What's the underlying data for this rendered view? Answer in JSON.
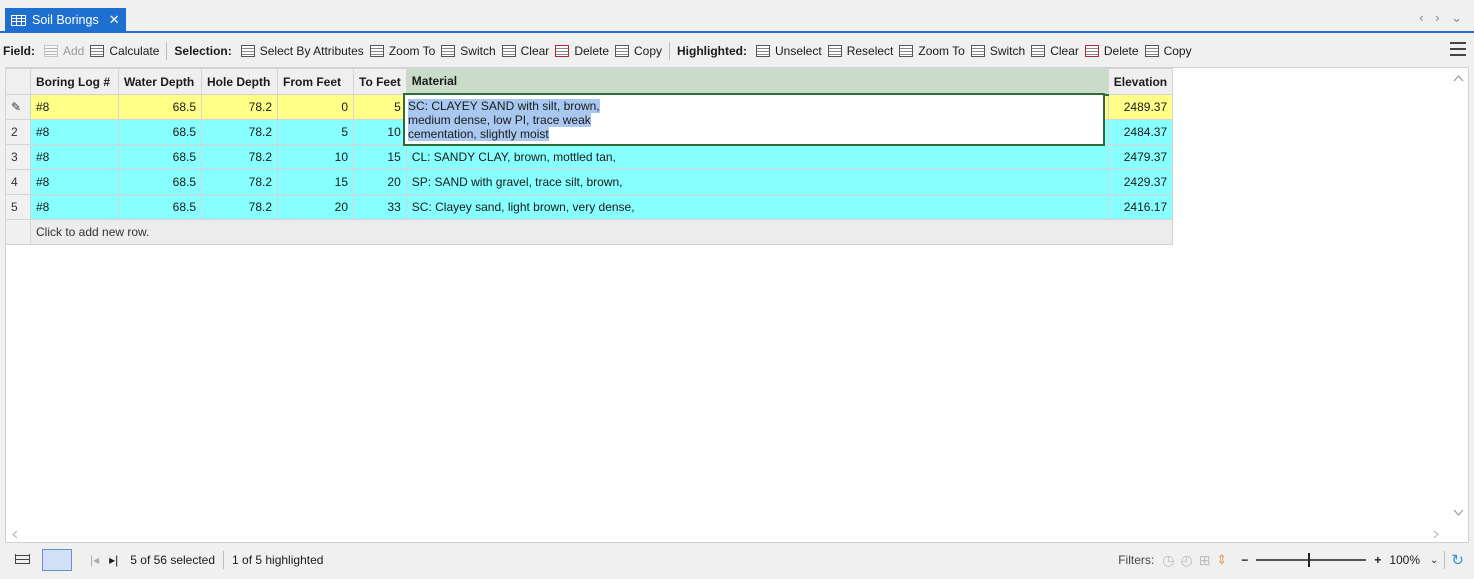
{
  "tab": {
    "title": "Soil Borings",
    "close": "✕"
  },
  "nav": {
    "arrows": "‹ › ⌄"
  },
  "toolbar": {
    "field_label": "Field:",
    "add": "Add",
    "calculate": "Calculate",
    "selection_label": "Selection:",
    "select_by_attributes": "Select By Attributes",
    "zoom_to": "Zoom To",
    "switch": "Switch",
    "clear": "Clear",
    "delete": "Delete",
    "copy": "Copy",
    "highlighted_label": "Highlighted:",
    "unselect": "Unselect",
    "reselect": "Reselect",
    "h_zoom_to": "Zoom To",
    "h_switch": "Switch",
    "h_clear": "Clear",
    "h_delete": "Delete",
    "h_copy": "Copy"
  },
  "table": {
    "columns": [
      "Boring Log #",
      "Water Depth",
      "Hole Depth",
      "From Feet",
      "To Feet",
      "Material",
      "Elevation"
    ],
    "rows": [
      {
        "rowhead": "✎",
        "log": "#8",
        "water": "68.5",
        "hole": "78.2",
        "from": "0",
        "to": "5",
        "material": "",
        "elev": "2489.37"
      },
      {
        "rowhead": "2",
        "log": "#8",
        "water": "68.5",
        "hole": "78.2",
        "from": "5",
        "to": "10",
        "material": "",
        "elev": "2484.37"
      },
      {
        "rowhead": "3",
        "log": "#8",
        "water": "68.5",
        "hole": "78.2",
        "from": "10",
        "to": "15",
        "material": "CL: SANDY CLAY, brown, mottled tan,",
        "elev": "2479.37"
      },
      {
        "rowhead": "4",
        "log": "#8",
        "water": "68.5",
        "hole": "78.2",
        "from": "15",
        "to": "20",
        "material": "SP: SAND with gravel, trace silt, brown,",
        "elev": "2429.37"
      },
      {
        "rowhead": "5",
        "log": "#8",
        "water": "68.5",
        "hole": "78.2",
        "from": "20",
        "to": "33",
        "material": "SC: Clayey sand, light brown, very dense,",
        "elev": "2416.17"
      }
    ],
    "add_row": "Click to add new row."
  },
  "editor": {
    "line1": "SC: CLAYEY SAND with silt, brown,",
    "line2": "medium dense, low PI, trace weak",
    "line3": "cementation, slightly moist"
  },
  "status": {
    "selected": "5 of 56 selected",
    "highlighted": "1 of 5 highlighted",
    "filters": "Filters:",
    "zoom": "100%",
    "minus": "−",
    "plus": "+"
  },
  "colors": {
    "accent": "#1f6fd1",
    "selected_row": "#87ffff",
    "highlighted_row": "#ffff88",
    "edit_border": "#2e6b3a"
  }
}
